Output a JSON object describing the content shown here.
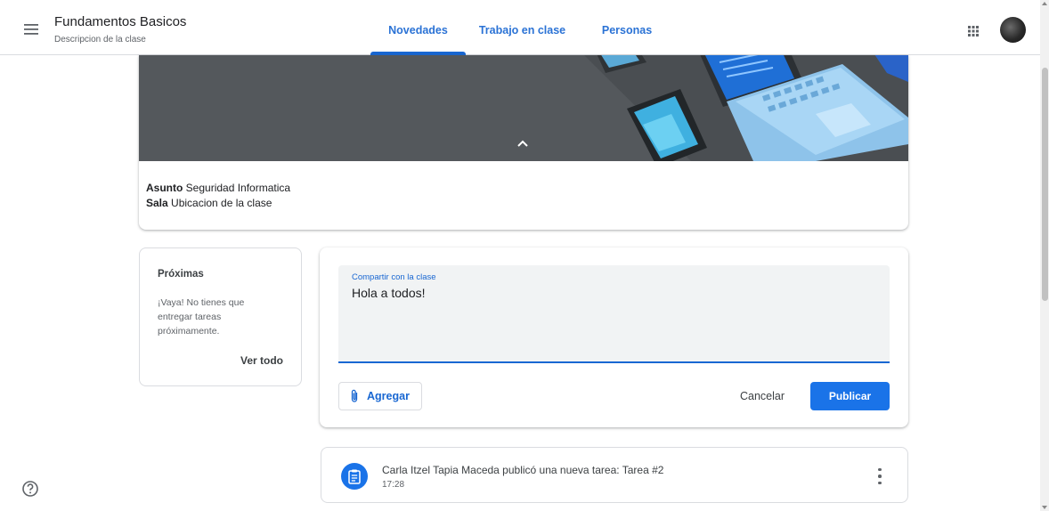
{
  "header": {
    "class_name": "Fundamentos Basicos",
    "class_description": "Descripcion de la clase",
    "tabs": [
      {
        "label": "Novedades",
        "active": true
      },
      {
        "label": "Trabajo en clase",
        "active": false
      },
      {
        "label": "Personas",
        "active": false
      }
    ]
  },
  "banner": {
    "subject_label": "Asunto",
    "subject_value": "Seguridad Informatica",
    "room_label": "Sala",
    "room_value": "Ubicacion de la clase"
  },
  "upcoming": {
    "title": "Próximas",
    "message": "¡Vaya! No tienes que entregar tareas próximamente.",
    "link": "Ver todo"
  },
  "compose": {
    "field_label": "Compartir con la clase",
    "field_value": "Hola a todos!",
    "attach_label": "Agregar",
    "cancel_label": "Cancelar",
    "publish_label": "Publicar"
  },
  "post": {
    "title": "Carla Itzel Tapia Maceda publicó una nueva tarea: Tarea #2",
    "time": "17:28"
  },
  "colors": {
    "accent": "#1967d2",
    "primary_button": "#1a73e8",
    "banner_bg": "#54585c"
  },
  "icons": [
    "menu-icon",
    "apps-grid-icon",
    "chevron-up-icon",
    "paperclip-icon",
    "assignment-icon",
    "more-vert-icon",
    "help-icon"
  ]
}
